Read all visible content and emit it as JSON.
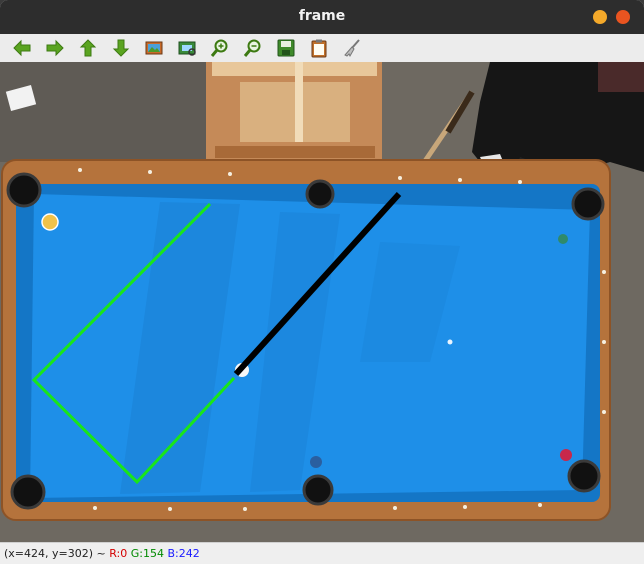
{
  "window": {
    "title": "frame"
  },
  "toolbar": {
    "icons": [
      "arrow-left-icon",
      "arrow-right-icon",
      "arrow-up-icon",
      "arrow-down-icon",
      "image-icon",
      "view-icon",
      "zoom-in-icon",
      "zoom-out-icon",
      "save-icon",
      "clipboard-icon",
      "brush-icon"
    ]
  },
  "status": {
    "coords": "(x=424, y=302) ~",
    "r": "R:0",
    "g": "G:154",
    "b": "B:242"
  },
  "colors": {
    "felt": "#1e8fe8",
    "rail": "#b5733c",
    "guide_line": "#19e619",
    "cue_stick": "#000000",
    "titlebar": "#2d2d2d",
    "minimize": "#f4a92a",
    "close": "#e95420"
  }
}
